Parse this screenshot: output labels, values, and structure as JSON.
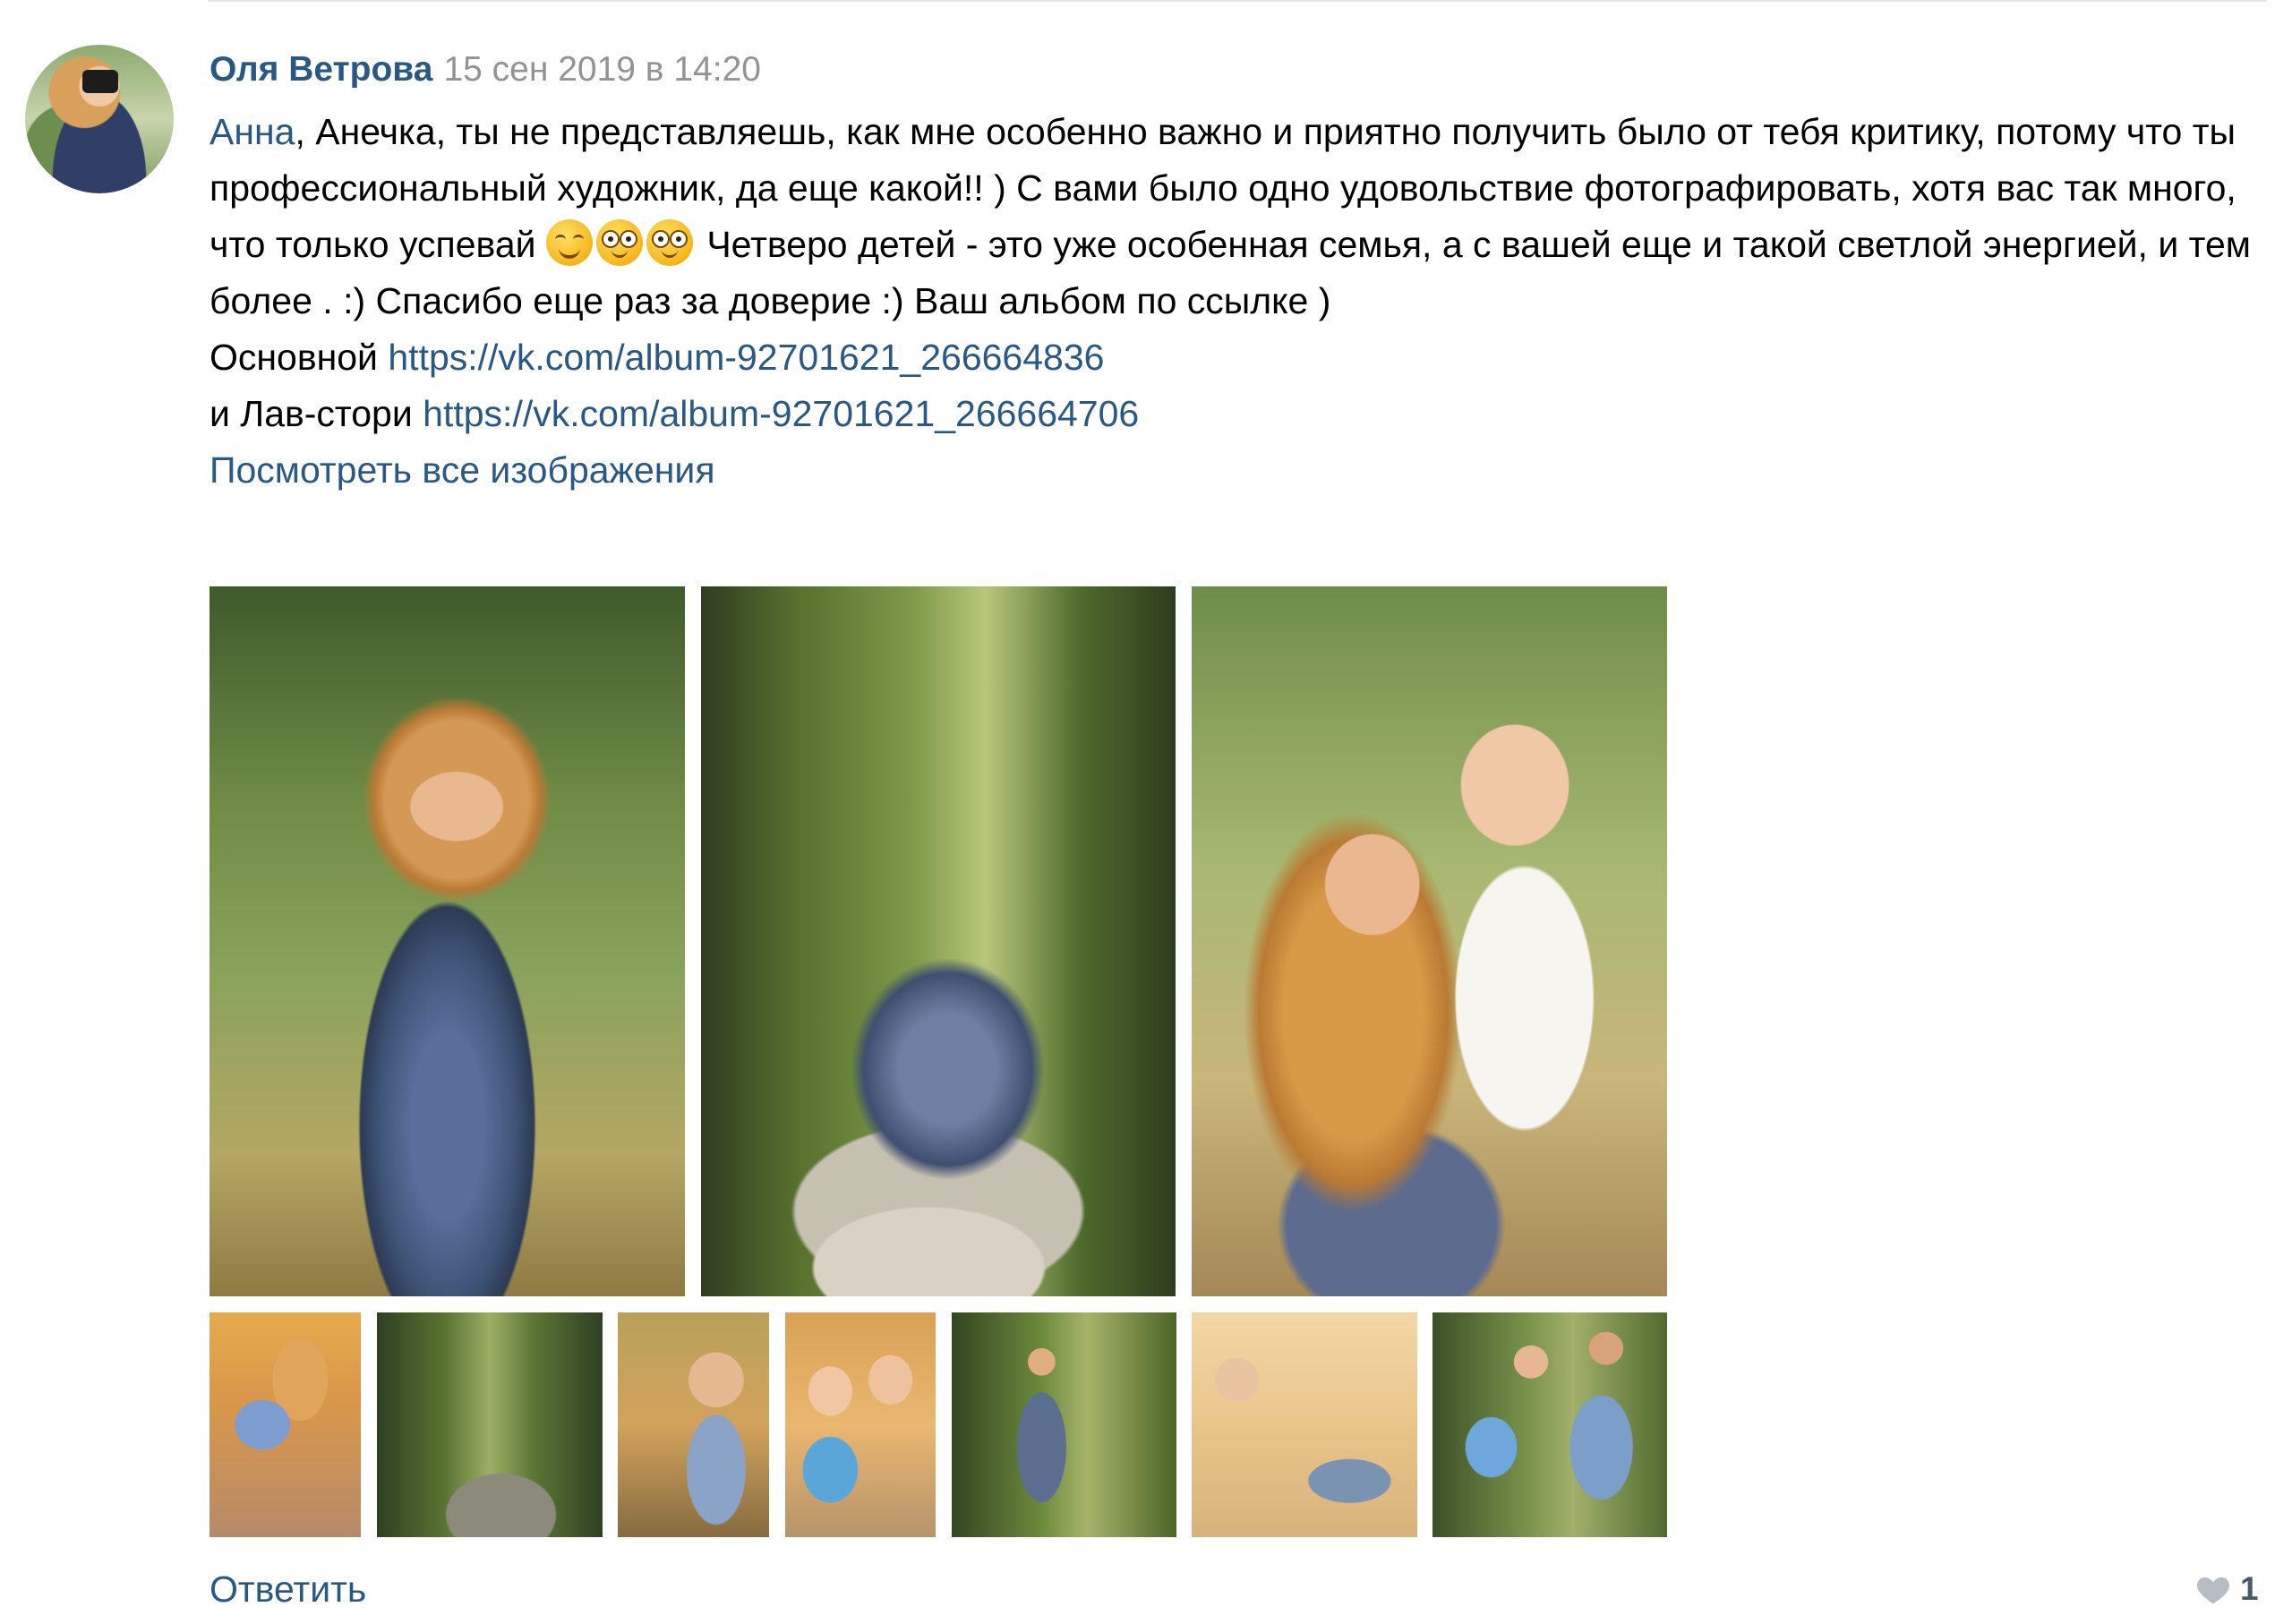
{
  "comment": {
    "author": "Оля Ветрова",
    "date": "15 сен 2019 в 14:20",
    "mention": "Анна",
    "text_1": ", Анечка, ты не представляешь, как мне особенно важно и приятно получить было от тебя критику, потому что ты профессиональный художник, да еще какой!! ) С вами было одно удовольствие фотографировать, хотя вас так много, что только успевай ",
    "text_2": " Четверо детей - это уже особенная семья, а с вашей еще и такой светлой энергией, и тем более . :) Спасибо еще раз за доверие :) Ваш альбом по ссылке )",
    "emojis": [
      "smiling-face-icon",
      "flushed-face-icon",
      "flushed-face-icon"
    ],
    "link_1_label": "Основной",
    "link_1_url": "https://vk.com/album-92701621_266664836",
    "link_2_label": "и Лав-стори",
    "link_2_url": "https://vk.com/album-92701621_266664706",
    "see_all": "Посмотреть все изображения"
  },
  "photos": {
    "large_count": 3,
    "thumb_count": 7
  },
  "footer": {
    "reply": "Ответить",
    "likes": "1"
  },
  "colors": {
    "link": "#2a5885",
    "date": "#939393",
    "text": "#000000",
    "like_icon": "#b8bcc4"
  }
}
